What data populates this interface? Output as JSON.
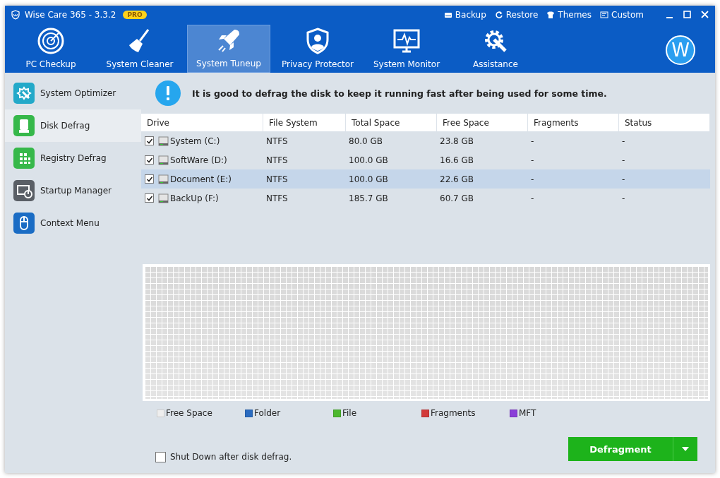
{
  "window": {
    "title": "Wise Care 365 - 3.3.2",
    "badge": "PRO"
  },
  "top_links": [
    "Backup",
    "Restore",
    "Themes",
    "Custom"
  ],
  "tabs": [
    {
      "label": "PC Checkup",
      "selected": false
    },
    {
      "label": "System Cleaner",
      "selected": false
    },
    {
      "label": "System Tuneup",
      "selected": true
    },
    {
      "label": "Privacy Protector",
      "selected": false
    },
    {
      "label": "System Monitor",
      "selected": false
    },
    {
      "label": "Assistance",
      "selected": false
    }
  ],
  "avatar": {
    "letter": "W"
  },
  "sidebar": {
    "items": [
      {
        "label": "System Optimizer",
        "selected": false
      },
      {
        "label": "Disk Defrag",
        "selected": true
      },
      {
        "label": "Registry Defrag",
        "selected": false
      },
      {
        "label": "Startup Manager",
        "selected": false
      },
      {
        "label": "Context Menu",
        "selected": false
      }
    ]
  },
  "notice": "It is good to defrag the disk to keep it running fast after being used for some time.",
  "table": {
    "columns": [
      "Drive",
      "File System",
      "Total Space",
      "Free Space",
      "Fragments",
      "Status"
    ],
    "rows": [
      {
        "checked": true,
        "selected": false,
        "cells": [
          "System (C:)",
          "NTFS",
          "80.0 GB",
          "23.8 GB",
          "-",
          "-"
        ]
      },
      {
        "checked": true,
        "selected": false,
        "cells": [
          "SoftWare (D:)",
          "NTFS",
          "100.0 GB",
          "16.6 GB",
          "-",
          "-"
        ]
      },
      {
        "checked": true,
        "selected": true,
        "cells": [
          "Document (E:)",
          "NTFS",
          "100.0 GB",
          "22.6 GB",
          "-",
          "-"
        ]
      },
      {
        "checked": true,
        "selected": false,
        "cells": [
          "BackUp (F:)",
          "NTFS",
          "185.7 GB",
          "60.7 GB",
          "-",
          "-"
        ]
      }
    ]
  },
  "legend": [
    {
      "label": "Free Space",
      "color": "#eeeeee"
    },
    {
      "label": "Folder",
      "color": "#2a6bc0"
    },
    {
      "label": "File",
      "color": "#4cb82e"
    },
    {
      "label": "Fragments",
      "color": "#d23a3a"
    },
    {
      "label": "MFT",
      "color": "#8a3ed8"
    }
  ],
  "shutdown_option": {
    "label": "Shut Down after disk defrag.",
    "checked": false
  },
  "action_button": {
    "label": "Defragment"
  }
}
